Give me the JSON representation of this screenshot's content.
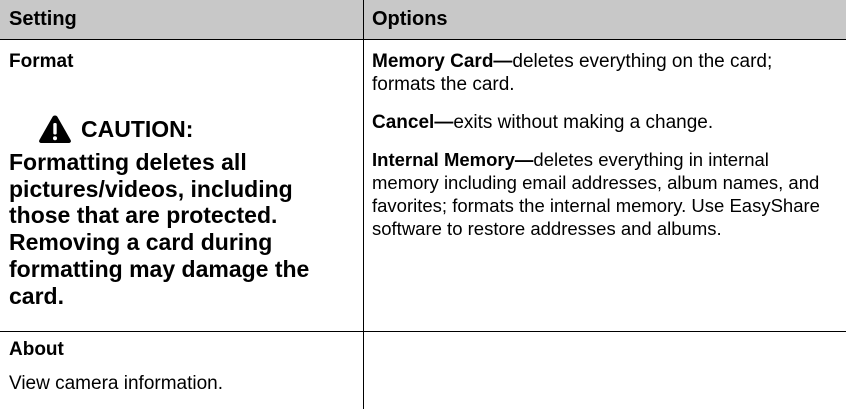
{
  "table": {
    "headers": {
      "setting": "Setting",
      "options": "Options"
    },
    "format_row": {
      "title": "Format",
      "caution_label": "CAUTION:",
      "caution_text": "Formatting deletes all pictures/videos, including those that are protected. Removing a card during formatting may damage the card.",
      "options": [
        {
          "term": "Memory Card",
          "dash": "—",
          "desc": "deletes everything on the card; formats the card."
        },
        {
          "term": "Cancel",
          "dash": "—",
          "desc": "exits without making a change."
        },
        {
          "term": "Internal Memory",
          "dash": "—",
          "desc": "deletes everything in internal memory including email addresses, album names, and favorites; formats the internal memory. Use EasyShare software to restore addresses and albums."
        }
      ]
    },
    "about_row": {
      "title": "About",
      "description": "View camera information."
    }
  },
  "colors": {
    "header_bg": "#c8c8c8",
    "rule": "#000000"
  },
  "icons": {
    "caution": "warning-triangle-icon"
  }
}
